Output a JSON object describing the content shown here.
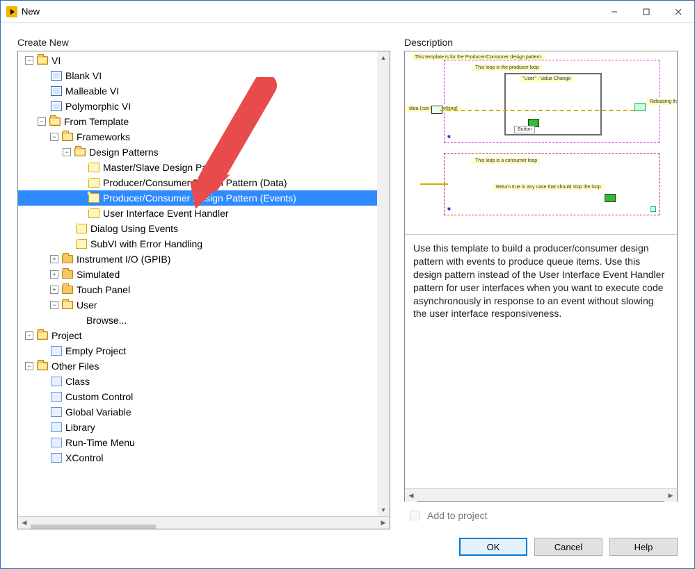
{
  "window": {
    "title": "New"
  },
  "panes": {
    "create_new": "Create New",
    "description": "Description"
  },
  "tree": {
    "vi": "VI",
    "blank_vi": "Blank VI",
    "malleable_vi": "Malleable VI",
    "polymorphic_vi": "Polymorphic VI",
    "from_template": "From Template",
    "frameworks": "Frameworks",
    "design_patterns": "Design Patterns",
    "master_slave": "Master/Slave Design Pattern",
    "pc_data": "Producer/Consumer Design Pattern (Data)",
    "pc_events": "Producer/Consumer Design Pattern (Events)",
    "ui_event_handler": "User Interface Event Handler",
    "dialog_events": "Dialog Using Events",
    "subvi_error": "SubVI with Error Handling",
    "instrument_io": "Instrument I/O (GPIB)",
    "simulated": "Simulated",
    "touch_panel": "Touch Panel",
    "user": "User",
    "browse": "Browse...",
    "project": "Project",
    "empty_project": "Empty Project",
    "other_files": "Other Files",
    "class": "Class",
    "custom_control": "Custom Control",
    "global_variable": "Global Variable",
    "library": "Library",
    "runtime_menu": "Run-Time Menu",
    "xcontrol": "XControl"
  },
  "description_text": "Use this template to build a producer/consumer design pattern with events to produce queue items. Use this design pattern instead of the User Interface Event Handler pattern for user interfaces when you want to execute code asynchronously in response to an event without slowing the user interface responsiveness.",
  "add_to_project": "Add to project",
  "buttons": {
    "ok": "OK",
    "cancel": "Cancel",
    "help": "Help"
  }
}
